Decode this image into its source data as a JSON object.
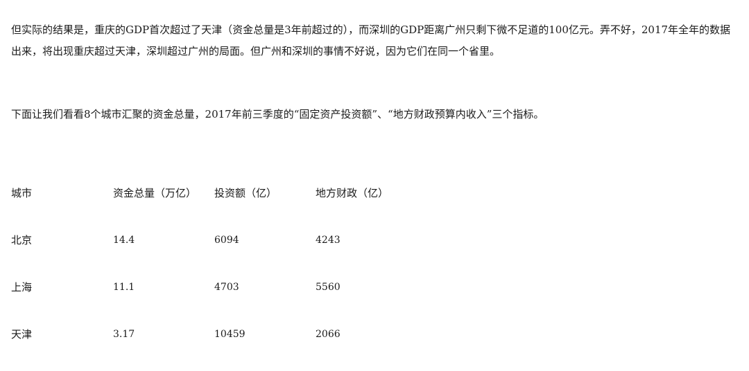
{
  "paragraphs": [
    "但实际的结果是，重庆的GDP首次超过了天津（资金总量是3年前超过的），而深圳的GDP距离广州只剩下微不足道的100亿元。弄不好，2017年全年的数据出来，将出现重庆超过天津，深圳超过广州的局面。但广州和深圳的事情不好说，因为它们在同一个省里。",
    "下面让我们看看8个城市汇聚的资金总量，2017年前三季度的“固定资产投资额”、“地方财政预算内收入”三个指标。"
  ],
  "table": {
    "headers": [
      "城市",
      "资金总量（万亿）",
      "投资额（亿）",
      "地方财政（亿）"
    ],
    "rows": [
      [
        "北京",
        "14.4",
        "6094",
        "4243"
      ],
      [
        "上海",
        "11.1",
        "4703",
        "5560"
      ],
      [
        "天津",
        "3.17",
        "10459",
        "2066"
      ]
    ]
  }
}
